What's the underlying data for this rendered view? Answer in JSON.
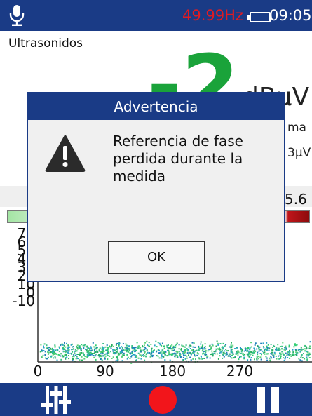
{
  "status_bar": {
    "frequency": "49.99Hz",
    "time": "09:05",
    "icons": [
      "microphone-icon",
      "battery-icon"
    ]
  },
  "measurement": {
    "mode": "Ultrasonidos",
    "value": "-2",
    "unit": "dBμV",
    "side_text_1": "ma",
    "side_text_2": "3μV",
    "side_text_3": "5.6"
  },
  "plot": {
    "y_ticks": [
      "70",
      "60",
      "50",
      "40",
      "30",
      "20",
      "10",
      "0",
      "-10"
    ],
    "x_ticks": [
      "0",
      "90",
      "180",
      "270"
    ]
  },
  "dialog": {
    "title": "Advertencia",
    "message": "Referencia de fase perdida durante la medida",
    "ok_label": "OK",
    "icon": "warning-icon"
  },
  "toolbar": {
    "icons": [
      "settings-sliders-icon",
      "record-icon",
      "pause-icon"
    ]
  },
  "colors": {
    "brand_blue": "#1a3b86",
    "alert_red": "#e11b22",
    "value_green": "#1aa33a"
  }
}
